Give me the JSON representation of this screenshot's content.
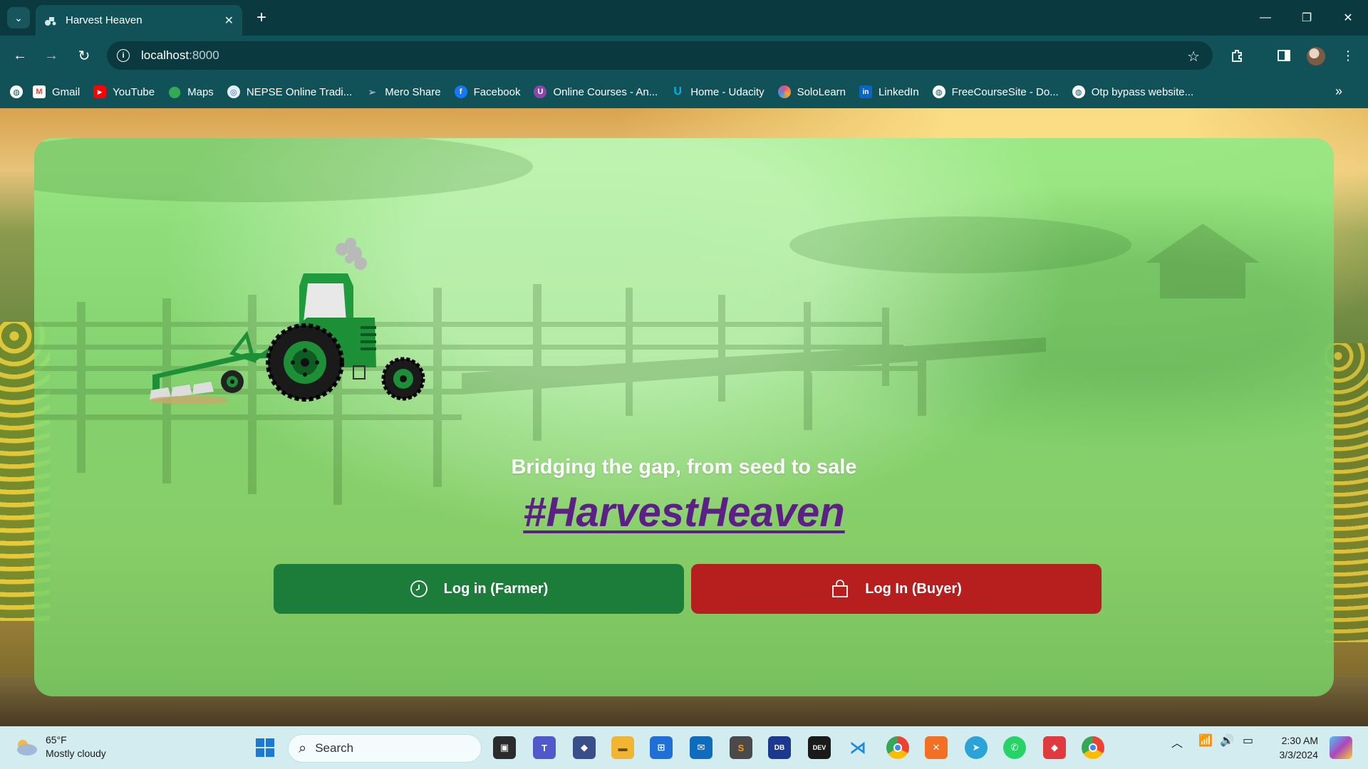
{
  "browser": {
    "tab_title": "Harvest Heaven",
    "url_host": "localhost",
    "url_port": ":8000",
    "bookmarks": [
      {
        "label": "Gmail",
        "icon": "gmail-icon",
        "color": "#ea4335"
      },
      {
        "label": "YouTube",
        "icon": "youtube-icon",
        "color": "#ff0000"
      },
      {
        "label": "Maps",
        "icon": "maps-icon",
        "color": "#34a853"
      },
      {
        "label": "NEPSE Online Tradi...",
        "icon": "nepse-icon",
        "color": "#3b6fb6"
      },
      {
        "label": "Mero Share",
        "icon": "meroshare-icon",
        "color": "#6b4fa0"
      },
      {
        "label": "Facebook",
        "icon": "facebook-icon",
        "color": "#1877f2"
      },
      {
        "label": "Online Courses - An...",
        "icon": "courses-icon",
        "color": "#8e44ad"
      },
      {
        "label": "Home - Udacity",
        "icon": "udacity-icon",
        "color": "#02b3e4"
      },
      {
        "label": "SoloLearn",
        "icon": "sololearn-icon",
        "color": "#e24a8d"
      },
      {
        "label": "LinkedIn",
        "icon": "linkedin-icon",
        "color": "#0a66c2"
      },
      {
        "label": "FreeCourseSite - Do...",
        "icon": "globe-icon",
        "color": "#5f6368"
      },
      {
        "label": "Otp bypass website...",
        "icon": "globe-icon",
        "color": "#5f6368"
      }
    ]
  },
  "page": {
    "tagline": "Bridging the gap, from seed to sale",
    "hashtag": "#HarvestHeaven",
    "farmer_button": "Log in (Farmer)",
    "buyer_button": "Log In (Buyer)",
    "colors": {
      "farmer": "#1c7d3a",
      "buyer": "#b71f1f",
      "hashtag": "#5b1f86"
    }
  },
  "taskbar": {
    "temperature": "65°F",
    "weather": "Mostly cloudy",
    "search_placeholder": "Search",
    "time": "2:30 AM",
    "date": "3/3/2024"
  }
}
